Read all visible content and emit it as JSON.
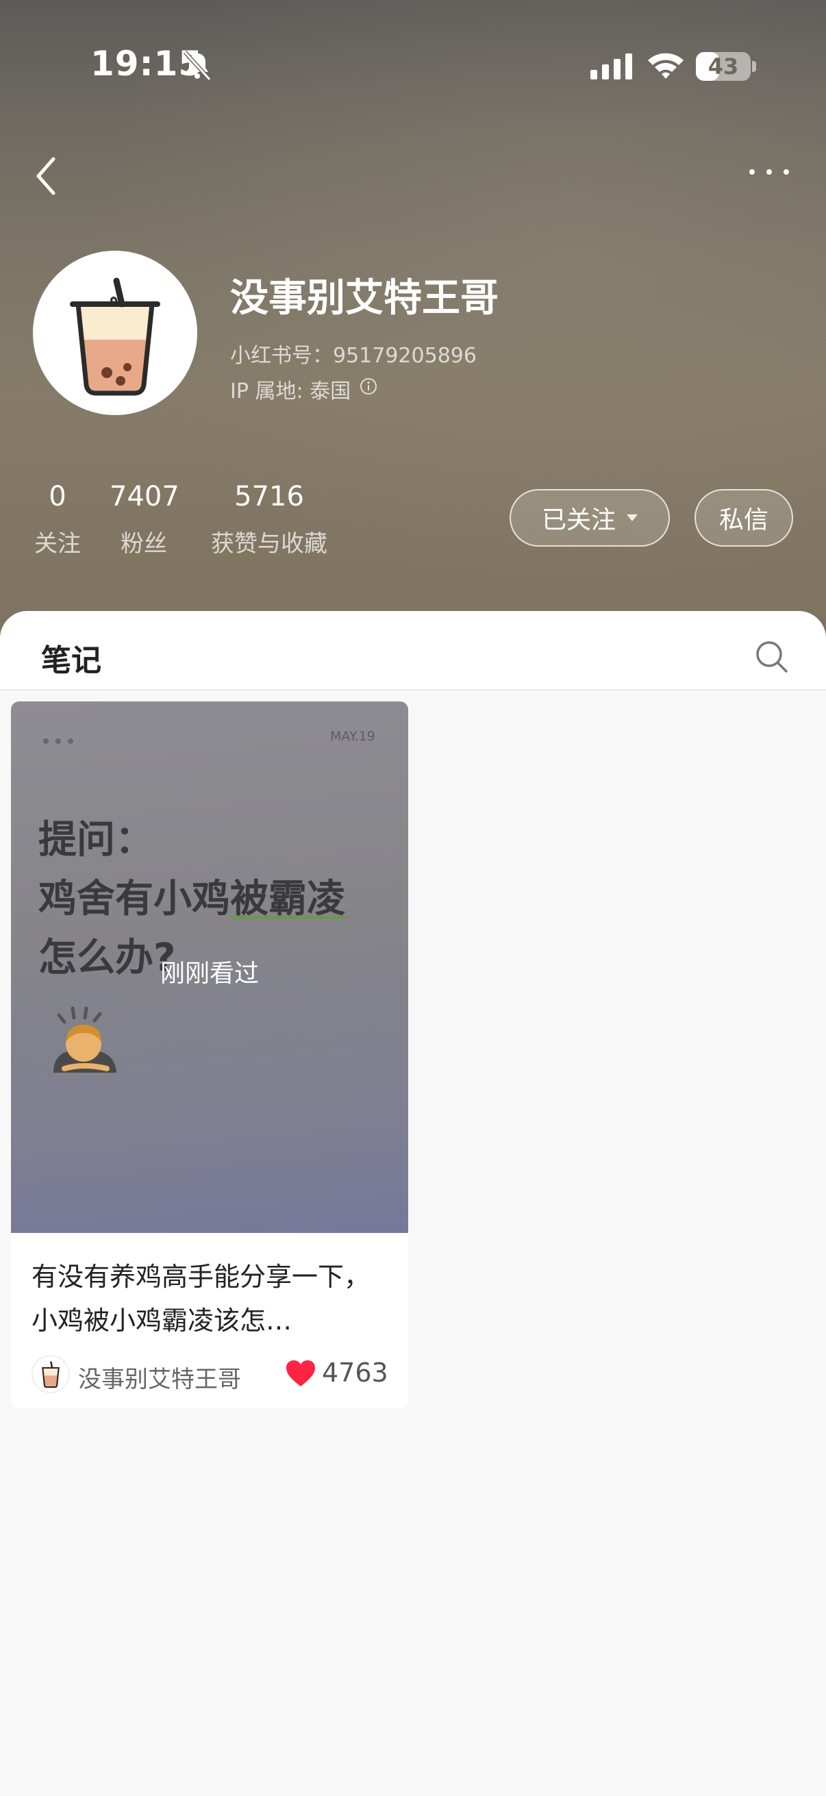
{
  "status_bar": {
    "time": "19:15",
    "battery": "43",
    "battery_level": 0.43,
    "icons": [
      "bell-muted-icon",
      "cellular-signal-icon",
      "wifi-icon",
      "battery-icon"
    ]
  },
  "nav": {
    "back_icon": "chevron-left-icon",
    "more_icon": "more-dots-icon"
  },
  "profile": {
    "name": "没事别艾特王哥",
    "id_text": "小红书号：95179205896",
    "ip_text": "IP 属地: 泰国",
    "avatar_icon": "bubble-tea-icon"
  },
  "stats": [
    {
      "value": "0",
      "label": "关注"
    },
    {
      "value": "7407",
      "label": "粉丝"
    },
    {
      "value": "5716",
      "label": "获赞与收藏"
    }
  ],
  "actions": {
    "followed_label": "已关注",
    "message_label": "私信"
  },
  "tabs": {
    "notes_label": "笔记",
    "search_icon": "search-icon"
  },
  "notes": [
    {
      "cover_date": "MAY.19",
      "cover_title_line1": "提问：",
      "cover_title_line2a": "鸡舍有小鸡",
      "cover_title_line2b": "被霸凌",
      "cover_title_line3": "怎么办?",
      "watched_label": "刚刚看过",
      "title": "有没有养鸡高手能分享一下，小鸡被小鸡霸凌该怎…",
      "author": "没事别艾特王哥",
      "likes": "4763",
      "colors": {
        "heart": "#ff2442"
      }
    }
  ]
}
